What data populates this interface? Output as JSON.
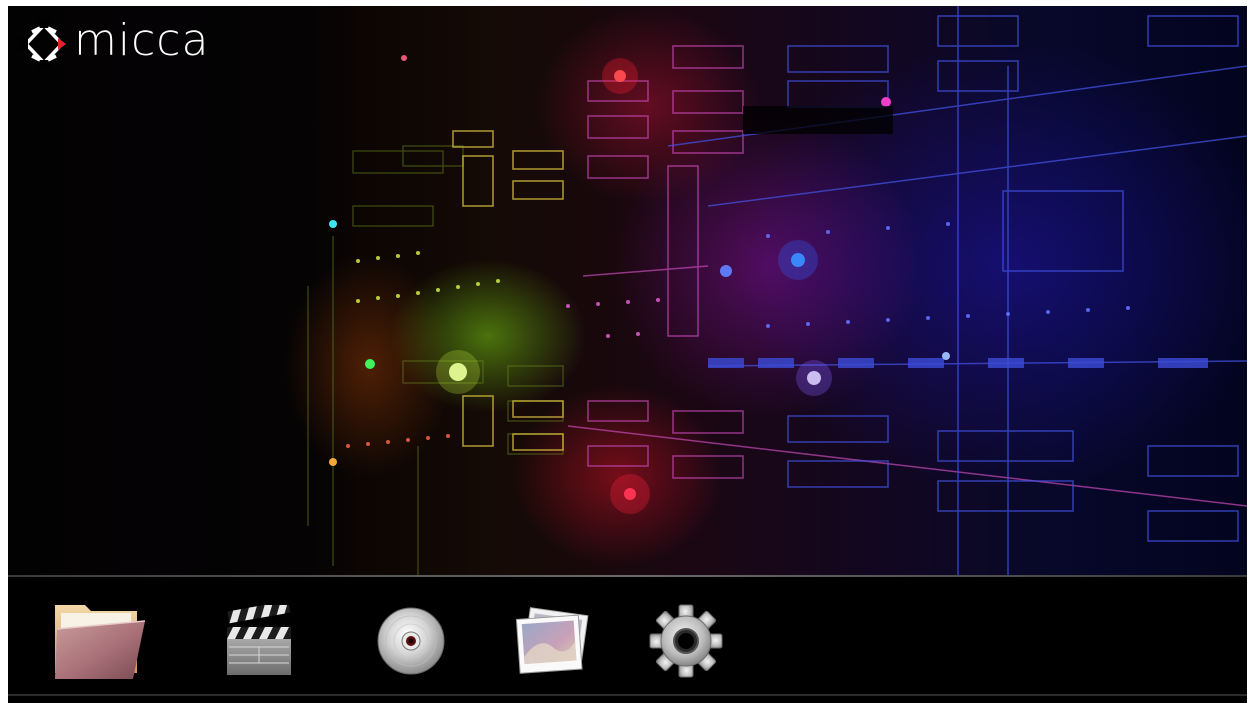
{
  "brand": {
    "name": "micca",
    "logo_icon": "micca-diamond-logo-icon",
    "accent_color": "#e8202a"
  },
  "wallpaper": {
    "description_colors": [
      "#6fd020",
      "#e82038",
      "#b020d0",
      "#2030e0"
    ]
  },
  "dock": {
    "items": [
      {
        "id": "file-browser",
        "icon": "folder-icon"
      },
      {
        "id": "movie",
        "icon": "clapperboard-icon"
      },
      {
        "id": "music",
        "icon": "disc-icon"
      },
      {
        "id": "photo",
        "icon": "photos-icon"
      },
      {
        "id": "settings",
        "icon": "gear-icon"
      }
    ]
  }
}
